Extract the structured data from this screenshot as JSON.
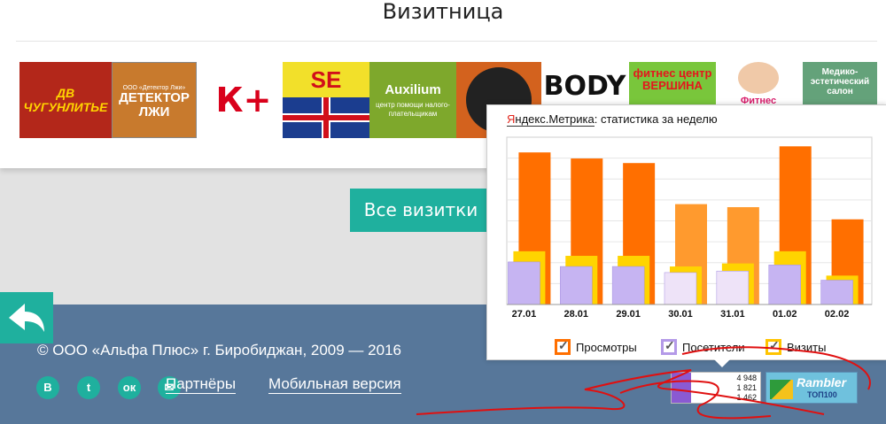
{
  "page": {
    "section_title": "Визитница"
  },
  "logos": {
    "dv": "ДВ ЧУГУНЛИТЬЕ",
    "detector_small": "ООО «Детектор Лжи»",
    "detector_big": "ДЕТЕКТОР ЛЖИ",
    "kplus": "К+",
    "se": "SE",
    "auxilium_name": "Auxilium",
    "auxilium_sub": "центр помощи налого-плательщикам",
    "body": "BODY",
    "fitness1": "фитнес центр ВЕРШИНА",
    "fitness2": "Фитнес",
    "medical": "Медико-эстетический салон"
  },
  "buttons": {
    "all_cards": "Все визитки"
  },
  "footer": {
    "copyright": "© ООО «Альфа Плюс» г. Биробиджан, 2009 — 2016",
    "social": {
      "vk": "В",
      "twitter": "t",
      "ok": "ок",
      "mail": "✉"
    },
    "links": {
      "partners": "Партнёры",
      "mobile": "Мобильная версия"
    }
  },
  "counters": {
    "li_views": "4 948",
    "li_visitors": "1 821",
    "li_today": "1 462",
    "rambler_word": "Rambler",
    "rambler_top": "ТОП100"
  },
  "metrika": {
    "brand_ya": "Я",
    "brand_rest": "ндекс.Метрика",
    "title_suffix": ": статистика за неделю",
    "legend": {
      "views": "Просмотры",
      "visitors": "Посетители",
      "visits": "Визиты"
    }
  },
  "colors": {
    "views": "#ff6f00",
    "views_light": "#ff9a2e",
    "visitors": "#c6b4f2",
    "visits": "#ffd400",
    "accent": "#1fb09e",
    "footer": "#57779a"
  },
  "chart_data": {
    "type": "bar",
    "title": "статистика за неделю",
    "categories": [
      "27.01",
      "28.01",
      "29.01",
      "30.01",
      "31.01",
      "01.02",
      "02.02"
    ],
    "series": [
      {
        "name": "Просмотры",
        "values": [
          100,
          96,
          93,
          66,
          64,
          104,
          56
        ]
      },
      {
        "name": "Визиты",
        "values": [
          35,
          32,
          32,
          25,
          27,
          35,
          19
        ]
      },
      {
        "name": "Посетители",
        "values": [
          28,
          25,
          25,
          21,
          22,
          26,
          16
        ]
      }
    ],
    "ylim": [
      0,
      110
    ],
    "grid": true,
    "legend": "bottom"
  }
}
